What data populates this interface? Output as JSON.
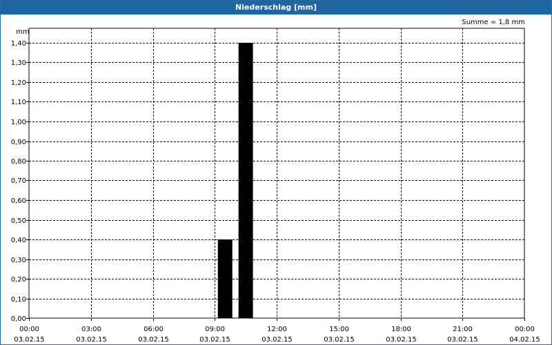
{
  "window": {
    "title": "Niederschlag [mm]"
  },
  "summary": {
    "text": "Summe = 1,8 mm"
  },
  "chart_data": {
    "type": "bar",
    "title": "Niederschlag [mm]",
    "ylabel": "mm",
    "ylim": [
      0,
      1.4
    ],
    "yticks": [
      "0,00",
      "0,10",
      "0,20",
      "0,30",
      "0,40",
      "0,50",
      "0,60",
      "0,70",
      "0,80",
      "0,90",
      "1,00",
      "1,10",
      "1,20",
      "1,30",
      "1,40"
    ],
    "xlim_hours": [
      0,
      24
    ],
    "xticks": [
      {
        "time": "00:00",
        "date": "03.02.15"
      },
      {
        "time": "03:00",
        "date": "03.02.15"
      },
      {
        "time": "06:00",
        "date": "03.02.15"
      },
      {
        "time": "09:00",
        "date": "03.02.15"
      },
      {
        "time": "12:00",
        "date": "03.02.15"
      },
      {
        "time": "15:00",
        "date": "03.02.15"
      },
      {
        "time": "18:00",
        "date": "03.02.15"
      },
      {
        "time": "21:00",
        "date": "03.02.15"
      },
      {
        "time": "00:00",
        "date": "04.02.15"
      }
    ],
    "bars": [
      {
        "start": "09:00",
        "end": "10:00",
        "value": 0.4
      },
      {
        "start": "10:00",
        "end": "11:00",
        "value": 1.4
      }
    ],
    "grid": true,
    "bar_color": "#000000"
  }
}
